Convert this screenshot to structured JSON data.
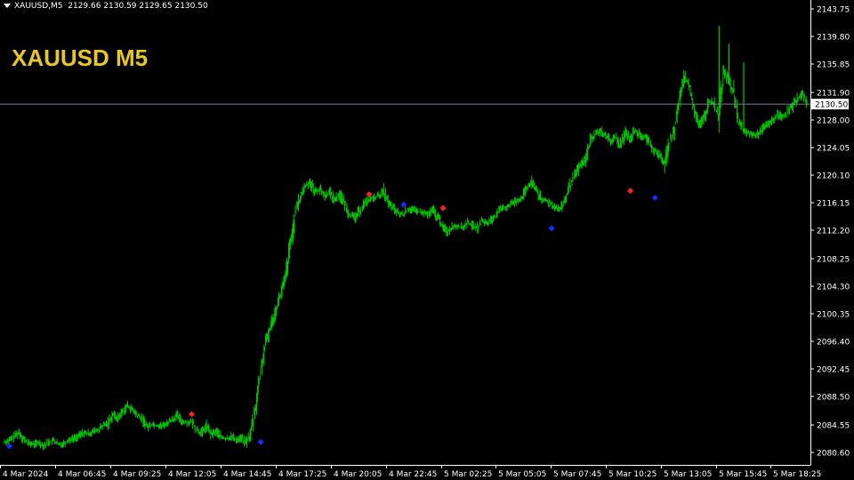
{
  "header": {
    "symbol": "XAUUSD,M5",
    "ohlc": "2129.66 2130.59 2129.65 2130.50"
  },
  "overlay_title": "XAUUSD M5",
  "colors": {
    "background": "#000000",
    "candle": "#00c800",
    "axis": "#ffffff",
    "buy_arrow": "#1030ff",
    "sell_arrow": "#ff2020",
    "price_line": "#7a8090",
    "title": "#e6c72a"
  },
  "chart_data": {
    "type": "line",
    "title": "XAUUSD M5",
    "ylim": [
      2078.5,
      2145.5
    ],
    "y_ticks": [
      "2143.75",
      "2139.80",
      "2135.85",
      "2131.90",
      "2128.00",
      "2124.05",
      "2120.10",
      "2116.15",
      "2112.20",
      "2108.25",
      "2104.30",
      "2100.35",
      "2096.40",
      "2092.45",
      "2088.50",
      "2084.55",
      "2080.60"
    ],
    "x_ticks": [
      "4 Mar 2024",
      "4 Mar 06:45",
      "4 Mar 09:25",
      "4 Mar 12:05",
      "4 Mar 14:45",
      "4 Mar 17:25",
      "4 Mar 20:05",
      "4 Mar 22:45",
      "5 Mar 02:25",
      "5 Mar 05:05",
      "5 Mar 07:45",
      "5 Mar 10:25",
      "5 Mar 13:05",
      "5 Mar 15:45",
      "5 Mar 18:25"
    ],
    "current_price": "2130.50",
    "series": [
      {
        "values": [
          2081.8,
          2082.0,
          2082.6,
          2083.2,
          2082.1,
          2081.6,
          2081.5,
          2081.7,
          2081.3,
          2081.8,
          2082.0,
          2081.4,
          2081.6,
          2082.1,
          2082.3,
          2082.6,
          2083.1,
          2083.0,
          2083.3,
          2083.5,
          2084.1,
          2084.5,
          2085.8,
          2085.2,
          2086.2,
          2087.0,
          2086.4,
          2085.6,
          2085.1,
          2084.0,
          2084.4,
          2084.2,
          2084.1,
          2084.5,
          2085.0,
          2085.6,
          2084.8,
          2084.6,
          2084.7,
          2083.7,
          2083.0,
          2084.1,
          2082.9,
          2083.3,
          2082.5,
          2082.2,
          2082.6,
          2082.1,
          2082.4,
          2081.7,
          2083.0,
          2087.0,
          2092.0,
          2095.8,
          2098.5,
          2100.6,
          2103.0,
          2105.2,
          2110.0,
          2114.5,
          2117.0,
          2118.6,
          2119.3,
          2117.9,
          2118.2,
          2117.3,
          2117.8,
          2116.7,
          2117.6,
          2116.1,
          2114.7,
          2114.0,
          2115.0,
          2116.2,
          2116.7,
          2117.0,
          2117.3,
          2117.9,
          2116.1,
          2115.4,
          2114.7,
          2114.6,
          2115.4,
          2115.2,
          2115.0,
          2114.8,
          2114.6,
          2115.2,
          2114.1,
          2112.8,
          2112.1,
          2112.9,
          2113.0,
          2112.7,
          2113.4,
          2113.0,
          2112.6,
          2113.6,
          2113.3,
          2114.0,
          2114.8,
          2115.4,
          2115.7,
          2116.2,
          2116.6,
          2117.0,
          2118.3,
          2119.2,
          2118.1,
          2116.6,
          2116.6,
          2116.1,
          2115.6,
          2115.3,
          2117.0,
          2119.3,
          2120.5,
          2121.8,
          2122.6,
          2125.4,
          2126.3,
          2126.6,
          2126.0,
          2125.1,
          2125.7,
          2124.4,
          2126.5,
          2125.6,
          2126.8,
          2125.9,
          2125.8,
          2124.8,
          2123.7,
          2123.0,
          2122.0,
          2125.0,
          2126.8,
          2131.3,
          2134.5,
          2133.0,
          2129.8,
          2127.5,
          2128.5,
          2131.0,
          2130.6,
          2128.5,
          2135.7,
          2133.6,
          2132.0,
          2128.0,
          2126.6,
          2126.3,
          2126.0,
          2126.2,
          2127.1,
          2127.6,
          2128.2,
          2129.0,
          2128.6,
          2129.6,
          2130.2,
          2131.4,
          2131.9,
          2130.5
        ]
      }
    ],
    "markers": [
      {
        "type": "buy",
        "x_index": 1,
        "price": 2081.2
      },
      {
        "type": "sell",
        "x_index": 38,
        "price": 2085.8
      },
      {
        "type": "buy",
        "x_index": 52,
        "price": 2081.8
      },
      {
        "type": "sell",
        "x_index": 74,
        "price": 2117.5
      },
      {
        "type": "buy",
        "x_index": 81,
        "price": 2116.0
      },
      {
        "type": "sell",
        "x_index": 89,
        "price": 2115.5
      },
      {
        "type": "buy",
        "x_index": 111,
        "price": 2112.6
      },
      {
        "type": "sell",
        "x_index": 127,
        "price": 2118.0
      },
      {
        "type": "buy",
        "x_index": 132,
        "price": 2117.0
      }
    ]
  }
}
